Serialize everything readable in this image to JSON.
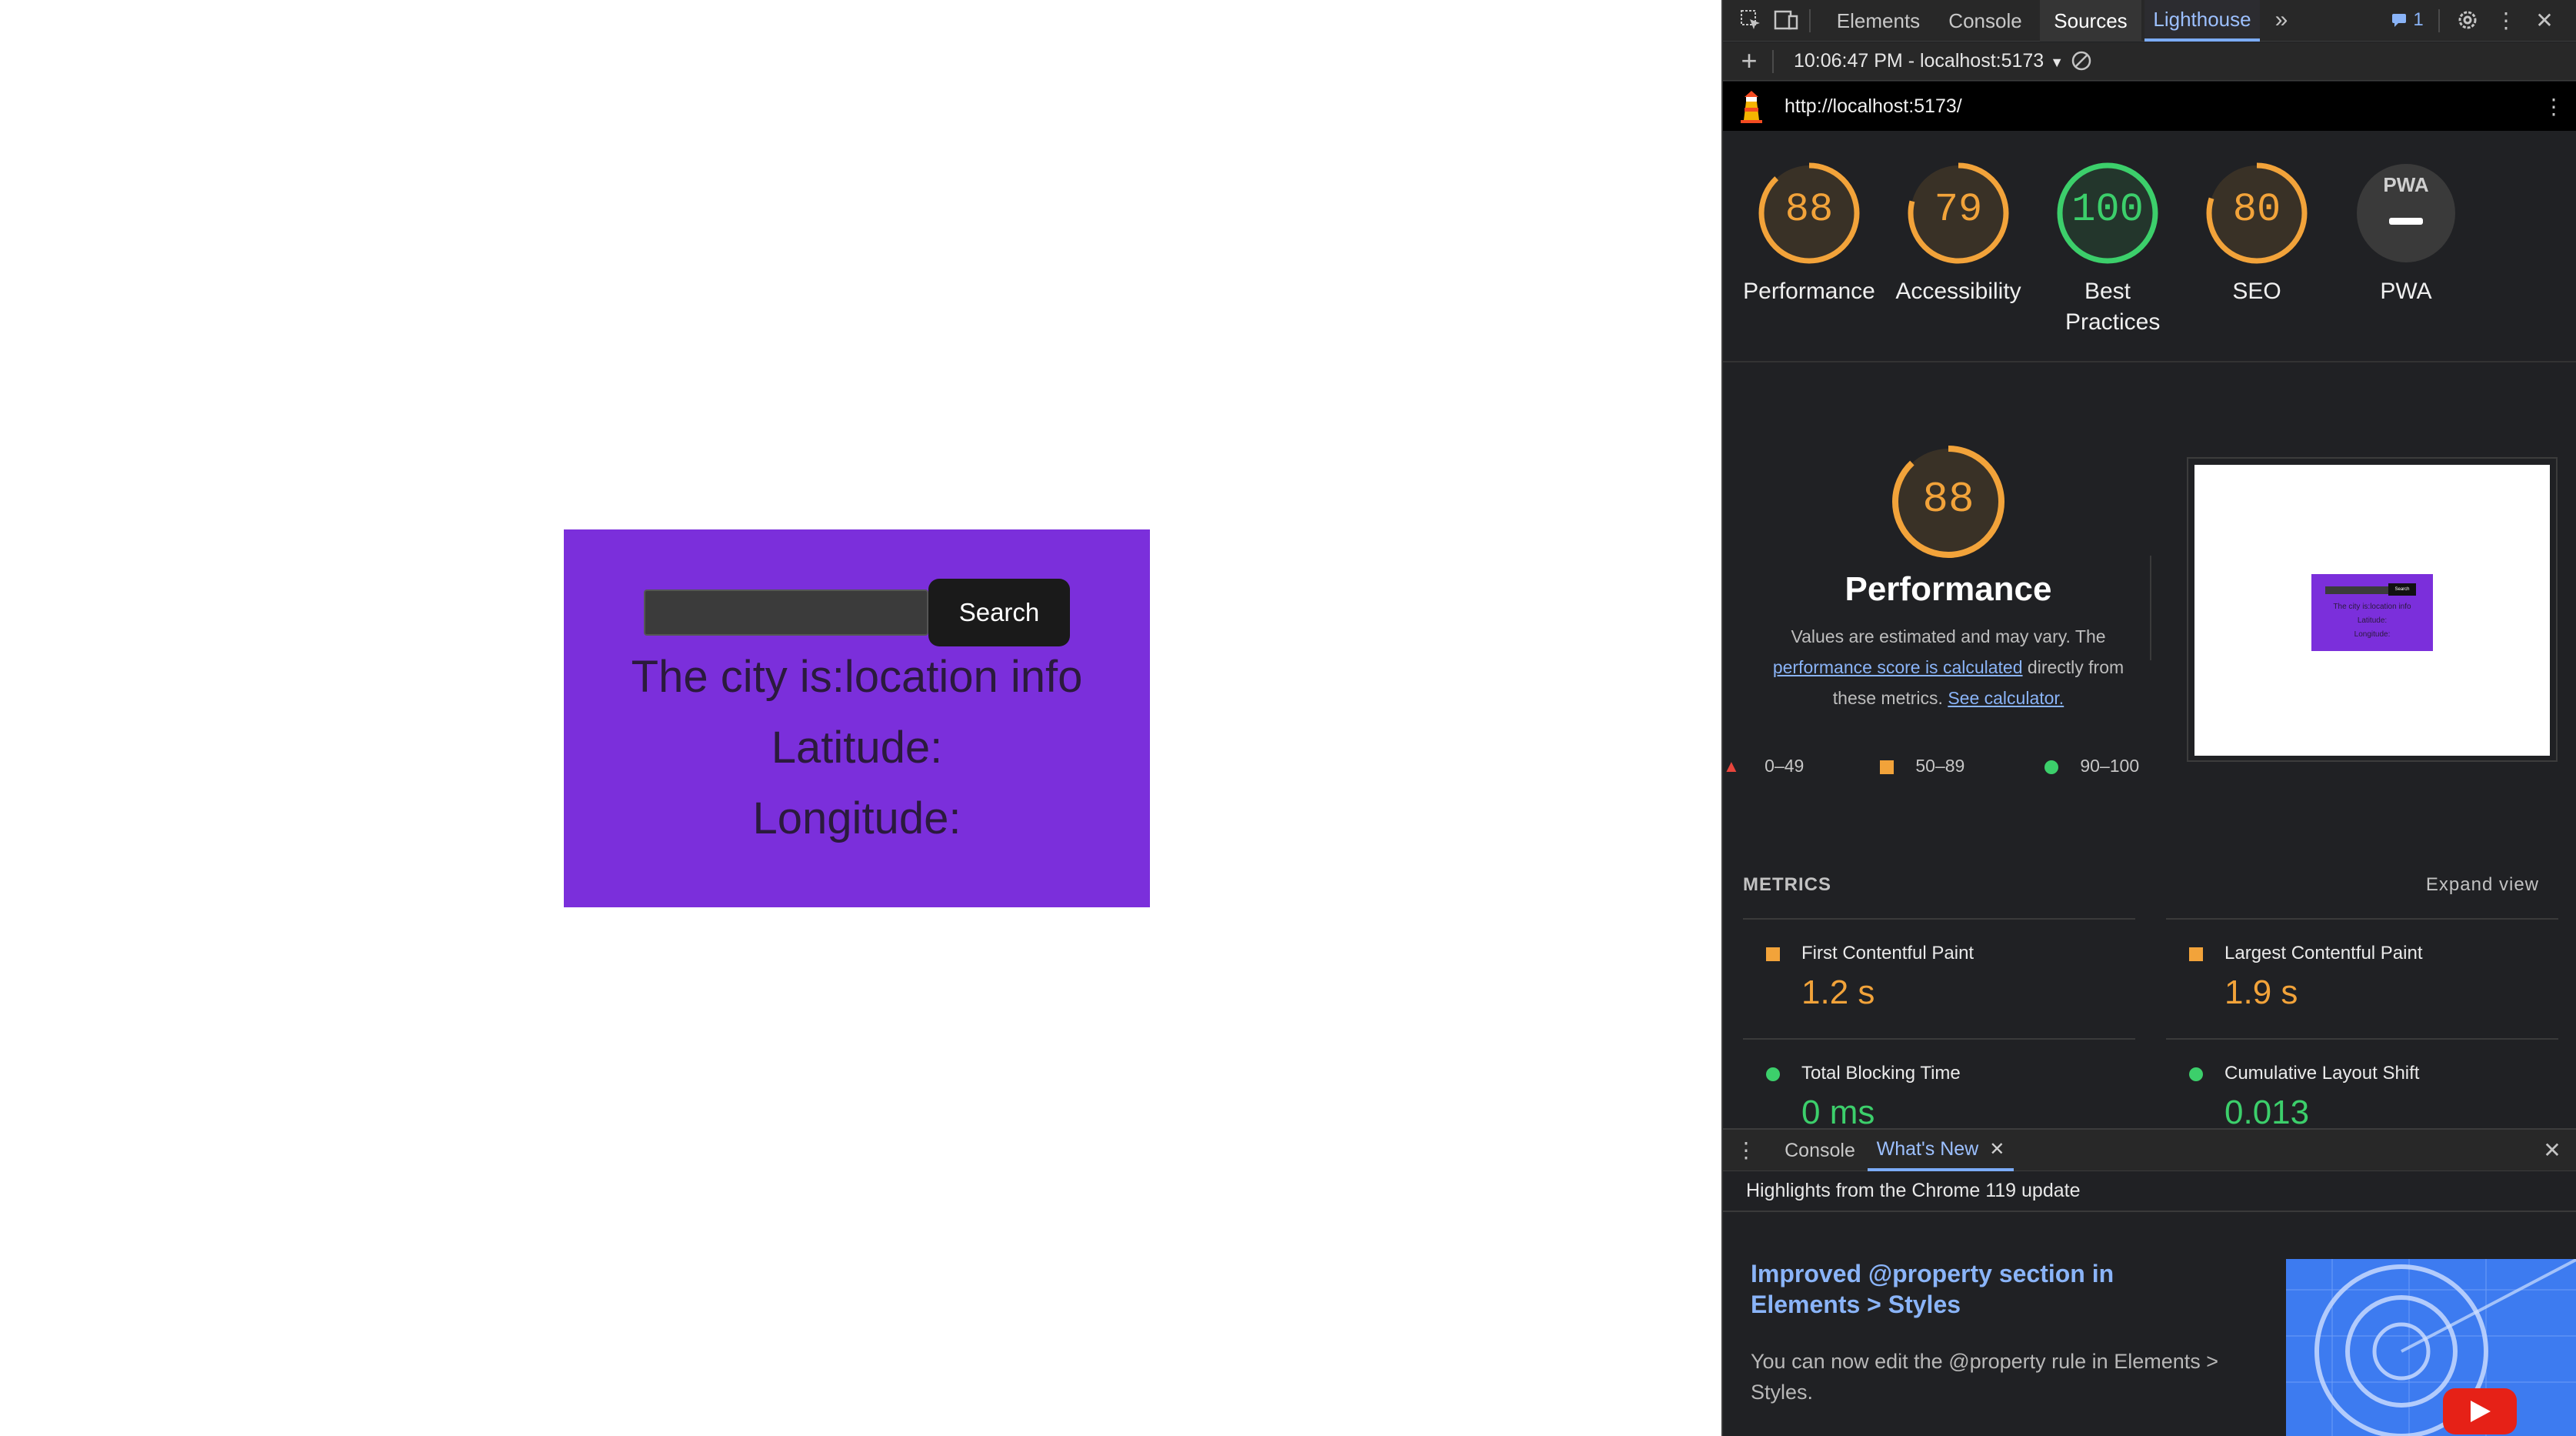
{
  "page": {
    "search_button": "Search",
    "city_line": "The city is:location info",
    "latitude_line": "Latitude:",
    "longitude_line": "Longitude:"
  },
  "devtools": {
    "tabs": [
      "Elements",
      "Console",
      "Sources",
      "Lighthouse"
    ],
    "active_tab": "Lighthouse",
    "issues_count": "1",
    "report_select": "10:06:47 PM - localhost:5173",
    "url": "http://localhost:5173/",
    "scores": [
      {
        "value": "88",
        "label": "Performance",
        "color": "#f2a33a",
        "fraction": 0.88
      },
      {
        "value": "79",
        "label": "Accessibility",
        "color": "#f2a33a",
        "fraction": 0.79
      },
      {
        "value": "100",
        "label": "Best Practices",
        "color": "#3ccf6b",
        "fraction": 1.0
      },
      {
        "value": "80",
        "label": "SEO",
        "color": "#f2a33a",
        "fraction": 0.8
      },
      {
        "value": "PWA",
        "label": "PWA",
        "color": "#555555",
        "fraction": 0
      }
    ],
    "performance": {
      "score": "88",
      "title": "Performance",
      "desc_1": "Values are estimated and may vary. The",
      "desc_link": "performance score is calculated",
      "desc_2": "directly from",
      "desc_3": "these metrics.",
      "calc_link": "See calculator."
    },
    "legend": [
      "0–49",
      "50–89",
      "90–100"
    ],
    "metrics_header": "METRICS",
    "expand_view": "Expand view",
    "metrics": [
      {
        "label": "First Contentful Paint",
        "value": "1.2 s",
        "color": "#f2a33a",
        "mark": "square"
      },
      {
        "label": "Largest Contentful Paint",
        "value": "1.9 s",
        "color": "#f2a33a",
        "mark": "square"
      },
      {
        "label": "Total Blocking Time",
        "value": "0 ms",
        "color": "#3ccf6b",
        "mark": "circle"
      },
      {
        "label": "Cumulative Layout Shift",
        "value": "0.013",
        "color": "#3ccf6b",
        "mark": "circle"
      }
    ],
    "drawer": {
      "tabs": [
        "Console",
        "What's New"
      ],
      "highlights": "Highlights from the Chrome 119 update",
      "article_title": "Improved @property section in Elements > Styles",
      "article_text": "You can now edit the @property rule in Elements > Styles."
    },
    "thumbnail": {
      "button": "Search",
      "line1": "The city is:location info",
      "line2": "Latitude:",
      "line3": "Longitude:"
    }
  }
}
